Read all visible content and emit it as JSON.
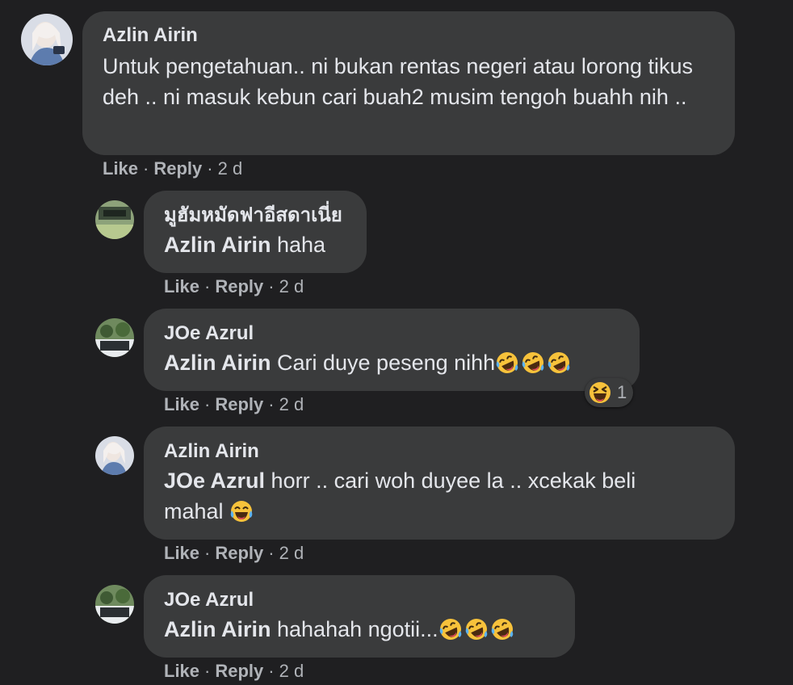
{
  "comments": [
    {
      "author": "Azlin Airin",
      "text": "Untuk pengetahuan.. ni bukan rentas negeri atau lorong tikus deh .. ni masuk kebun cari buah2 musim tengoh buahh nih ..",
      "like": "Like",
      "reply": "Reply",
      "time": "2 d"
    },
    {
      "author": "มูฮัมหมัดฟาอีสดาเนี่ย",
      "mention": "Azlin Airin",
      "text": " haha",
      "like": "Like",
      "reply": "Reply",
      "time": "2 d"
    },
    {
      "author": "JOe Azrul",
      "mention": "Azlin Airin",
      "text": " Cari duye peseng nihh",
      "emojis": [
        "rofl-emoji",
        "rofl-emoji",
        "rofl-emoji"
      ],
      "reaction": {
        "icon": "laughing-squint-emoji",
        "count": "1"
      },
      "like": "Like",
      "reply": "Reply",
      "time": "2 d"
    },
    {
      "author": "Azlin Airin",
      "mention": "JOe Azrul",
      "text_line1": " horr .. cari woh duyee la .. xcekak beli",
      "text_line2": "mahal ",
      "emojis": [
        "tears-of-joy-emoji"
      ],
      "like": "Like",
      "reply": "Reply",
      "time": "2 d"
    },
    {
      "author": "JOe Azrul",
      "mention": "Azlin Airin",
      "text": " hahahah ngotii...",
      "emojis": [
        "rofl-emoji",
        "rofl-emoji",
        "rofl-emoji"
      ],
      "like": "Like",
      "reply": "Reply",
      "time": "2 d"
    }
  ],
  "colors": {
    "background": "#1f1f21",
    "bubble": "#3a3b3c",
    "text": "#e4e6eb",
    "secondary": "#b0b3b8"
  }
}
